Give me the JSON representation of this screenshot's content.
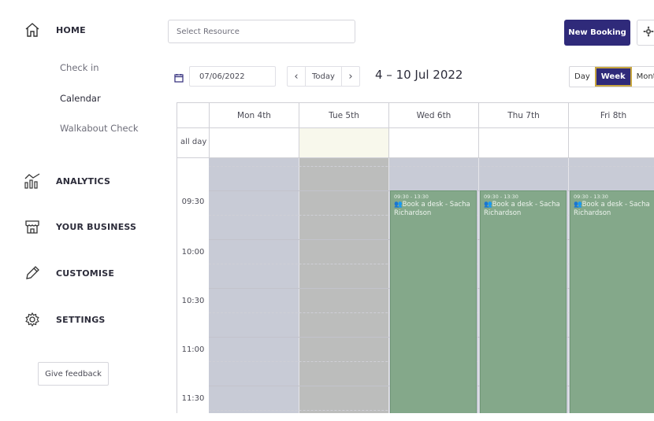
{
  "sidebar": {
    "home": "HOME",
    "sub_items": [
      "Check in",
      "Calendar",
      "Walkabout Check"
    ],
    "analytics": "ANALYTICS",
    "business": "YOUR BUSINESS",
    "customise": "CUSTOMISE",
    "settings": "SETTINGS",
    "feedback": "Give feedback"
  },
  "header": {
    "resource_placeholder": "Select Resource",
    "new_booking": "New Booking"
  },
  "toolbar": {
    "date_value": "07/06/2022",
    "prev": "‹",
    "today": "Today",
    "next": "›",
    "range": "4 – 10 Jul 2022",
    "views": [
      "Day",
      "Week",
      "Month"
    ],
    "active_view": "Week"
  },
  "calendar": {
    "days": [
      "Mon 4th",
      "Tue 5th",
      "Wed 6th",
      "Thu 7th",
      "Fri 8th"
    ],
    "allday_label": "all day",
    "times": [
      "09:30",
      "10:00",
      "10:30",
      "11:00",
      "11:30"
    ],
    "events": [
      {
        "time": "09:30 - 13:30",
        "title": "Book a desk - Sacha Richardson"
      },
      {
        "time": "09:30 - 13:30",
        "title": "Book a desk - Sacha Richardson"
      },
      {
        "time": "09:30 - 13:30",
        "title": "Book a desk - Sacha Richardson"
      }
    ]
  },
  "colors": {
    "accent": "#2f2a7a",
    "event_bg": "#84a88a",
    "past_day_bg": "#c8cbd6",
    "tue_bg": "#bcbdbc",
    "today_allday": "#f8f8ec"
  }
}
